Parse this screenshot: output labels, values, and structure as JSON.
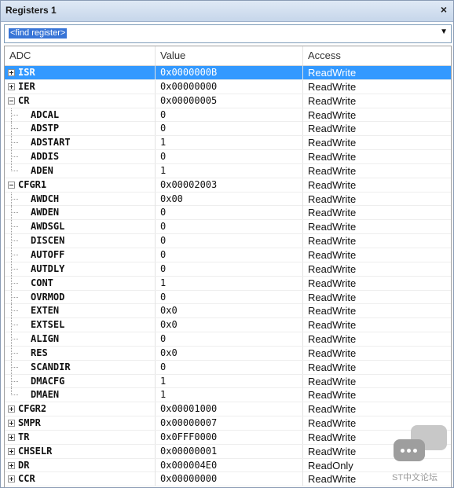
{
  "window": {
    "title": "Registers 1",
    "close_glyph": "×"
  },
  "find": {
    "placeholder": "<find register>",
    "dropdown_glyph": "▼"
  },
  "columns": [
    "ADC",
    "Value",
    "Access"
  ],
  "rows": [
    {
      "name": "ISR",
      "value": "0x0000000B",
      "access": "ReadWrite",
      "level": 0,
      "expanded": false,
      "selected": true
    },
    {
      "name": "IER",
      "value": "0x00000000",
      "access": "ReadWrite",
      "level": 0,
      "expanded": false
    },
    {
      "name": "CR",
      "value": "0x00000005",
      "access": "ReadWrite",
      "level": 0,
      "expanded": true
    },
    {
      "name": "ADCAL",
      "value": "0",
      "access": "ReadWrite",
      "level": 1
    },
    {
      "name": "ADSTP",
      "value": "0",
      "access": "ReadWrite",
      "level": 1
    },
    {
      "name": "ADSTART",
      "value": "1",
      "access": "ReadWrite",
      "level": 1
    },
    {
      "name": "ADDIS",
      "value": "0",
      "access": "ReadWrite",
      "level": 1
    },
    {
      "name": "ADEN",
      "value": "1",
      "access": "ReadWrite",
      "level": 1,
      "last": true
    },
    {
      "name": "CFGR1",
      "value": "0x00002003",
      "access": "ReadWrite",
      "level": 0,
      "expanded": true
    },
    {
      "name": "AWDCH",
      "value": "0x00",
      "access": "ReadWrite",
      "level": 1
    },
    {
      "name": "AWDEN",
      "value": "0",
      "access": "ReadWrite",
      "level": 1
    },
    {
      "name": "AWDSGL",
      "value": "0",
      "access": "ReadWrite",
      "level": 1
    },
    {
      "name": "DISCEN",
      "value": "0",
      "access": "ReadWrite",
      "level": 1
    },
    {
      "name": "AUTOFF",
      "value": "0",
      "access": "ReadWrite",
      "level": 1
    },
    {
      "name": "AUTDLY",
      "value": "0",
      "access": "ReadWrite",
      "level": 1
    },
    {
      "name": "CONT",
      "value": "1",
      "access": "ReadWrite",
      "level": 1
    },
    {
      "name": "OVRMOD",
      "value": "0",
      "access": "ReadWrite",
      "level": 1
    },
    {
      "name": "EXTEN",
      "value": "0x0",
      "access": "ReadWrite",
      "level": 1
    },
    {
      "name": "EXTSEL",
      "value": "0x0",
      "access": "ReadWrite",
      "level": 1
    },
    {
      "name": "ALIGN",
      "value": "0",
      "access": "ReadWrite",
      "level": 1
    },
    {
      "name": "RES",
      "value": "0x0",
      "access": "ReadWrite",
      "level": 1
    },
    {
      "name": "SCANDIR",
      "value": "0",
      "access": "ReadWrite",
      "level": 1
    },
    {
      "name": "DMACFG",
      "value": "1",
      "access": "ReadWrite",
      "level": 1
    },
    {
      "name": "DMAEN",
      "value": "1",
      "access": "ReadWrite",
      "level": 1,
      "last": true
    },
    {
      "name": "CFGR2",
      "value": "0x00001000",
      "access": "ReadWrite",
      "level": 0,
      "expanded": false
    },
    {
      "name": "SMPR",
      "value": "0x00000007",
      "access": "ReadWrite",
      "level": 0,
      "expanded": false
    },
    {
      "name": "TR",
      "value": "0x0FFF0000",
      "access": "ReadWrite",
      "level": 0,
      "expanded": false
    },
    {
      "name": "CHSELR",
      "value": "0x00000001",
      "access": "ReadWrite",
      "level": 0,
      "expanded": false
    },
    {
      "name": "DR",
      "value": "0x000004E0",
      "access": "ReadOnly",
      "level": 0,
      "expanded": false
    },
    {
      "name": "CCR",
      "value": "0x00000000",
      "access": "ReadWrite",
      "level": 0,
      "expanded": false
    }
  ],
  "watermark": {
    "text": "ST中文论坛",
    "icon": "chat-bubbles-icon"
  },
  "colors": {
    "selection": "#3399ff",
    "titlebar": "#c6d6ea"
  }
}
